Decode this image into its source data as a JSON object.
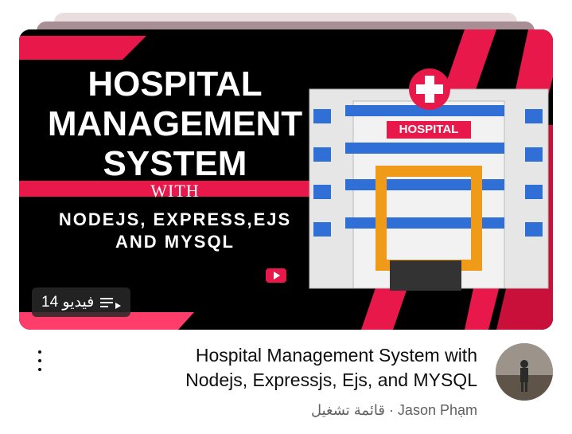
{
  "thumbnail": {
    "line1": "HOSPITAL",
    "line2": "MANAGEMENT",
    "line3": "SYSTEM",
    "line4": "WITH",
    "line5": "NODEJS, EXPRESS,EJS",
    "line6": "AND MYSQL",
    "sign": "HOSPITAL"
  },
  "badge": {
    "label": "14 فيديو",
    "icon": "playlist-icon"
  },
  "video": {
    "title_line1": "Hospital Management System with",
    "title_line2": "Nodejs, Expressjs, Ejs, and MYSQL",
    "subtitle": "قائمة تشغيل · Jason Phạm"
  },
  "colors": {
    "accent": "#e8194a",
    "title": "#0f0f0f",
    "subtitle": "#606060"
  }
}
